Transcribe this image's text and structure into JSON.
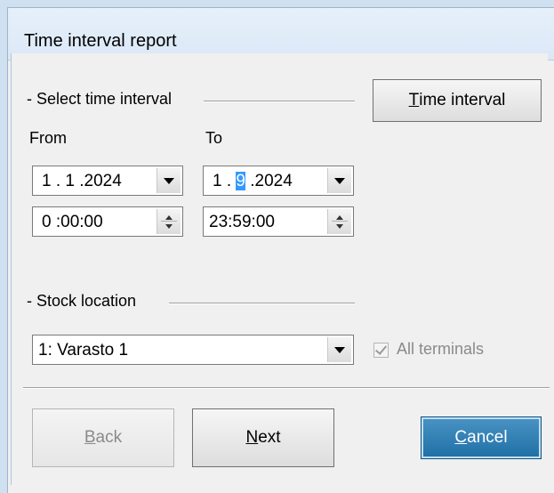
{
  "window": {
    "title": "Time interval report"
  },
  "interval_group": {
    "label": "- Select time interval",
    "button": {
      "label_pre": "",
      "label_mnemonic": "T",
      "label_post": "ime interval"
    },
    "from_label": "From",
    "to_label": "To",
    "from_date": "1 . 1 .2024",
    "to_date": {
      "pre": "1 . ",
      "highlight": "9",
      "post": " .2024"
    },
    "from_time": "0 :00:00",
    "to_time": "23:59:00"
  },
  "stock_group": {
    "label": "- Stock location",
    "selected": "1: Varasto 1",
    "all_terminals_label": "All terminals",
    "all_terminals_checked": true
  },
  "buttons": {
    "back": {
      "mnemonic": "B",
      "rest": "ack"
    },
    "next": {
      "mnemonic": "N",
      "rest": "ext"
    },
    "cancel": {
      "mnemonic": "C",
      "rest": "ancel"
    }
  },
  "colors": {
    "accent": "#1e6fa6",
    "highlight": "#3399ff",
    "title_bg": "#dbe8f6"
  }
}
